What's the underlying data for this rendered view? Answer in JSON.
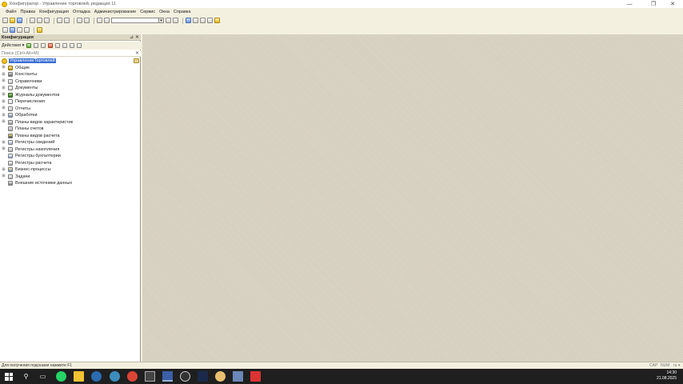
{
  "window": {
    "title": "Конфигуратор - Управление торговлей, редакция 11",
    "controls": {
      "minimize": "—",
      "maximize": "❐",
      "close": "✕"
    }
  },
  "menu": [
    "Файл",
    "Правка",
    "Конфигурация",
    "Отладка",
    "Администрирование",
    "Сервис",
    "Окна",
    "Справка"
  ],
  "panel": {
    "title": "Конфигурация",
    "pin": "⊿",
    "close": "✕",
    "actions_label": "Действия ▾",
    "search_placeholder": "Поиск (Ctrl+Alt+M)",
    "search_clear": "✕",
    "root_label": "УправлениеТорговлей",
    "items": [
      {
        "label": "Общие",
        "expander": "⊞",
        "icon": "common-icon"
      },
      {
        "label": "Константы",
        "expander": "⊞",
        "icon": "constants-icon"
      },
      {
        "label": "Справочники",
        "expander": "⊞",
        "icon": "catalogs-icon"
      },
      {
        "label": "Документы",
        "expander": "⊞",
        "icon": "documents-icon"
      },
      {
        "label": "Журналы документов",
        "expander": "⊞",
        "icon": "journals-icon"
      },
      {
        "label": "Перечисления",
        "expander": "⊞",
        "icon": "enumerations-icon"
      },
      {
        "label": "Отчеты",
        "expander": "⊞",
        "icon": "reports-icon"
      },
      {
        "label": "Обработки",
        "expander": "⊞",
        "icon": "data-processors-icon"
      },
      {
        "label": "Планы видов характеристик",
        "expander": "⊞",
        "icon": "chart-characteristics-icon"
      },
      {
        "label": "Планы счетов",
        "expander": "",
        "icon": "chart-accounts-icon"
      },
      {
        "label": "Планы видов расчета",
        "expander": "",
        "icon": "chart-calculation-icon"
      },
      {
        "label": "Регистры сведений",
        "expander": "⊞",
        "icon": "information-registers-icon"
      },
      {
        "label": "Регистры накопления",
        "expander": "⊞",
        "icon": "accumulation-registers-icon"
      },
      {
        "label": "Регистры бухгалтерии",
        "expander": "",
        "icon": "accounting-registers-icon"
      },
      {
        "label": "Регистры расчета",
        "expander": "",
        "icon": "calculation-registers-icon"
      },
      {
        "label": "Бизнес-процессы",
        "expander": "⊞",
        "icon": "business-processes-icon"
      },
      {
        "label": "Задачи",
        "expander": "⊞",
        "icon": "tasks-icon"
      },
      {
        "label": "Внешние источники данных",
        "expander": "",
        "icon": "external-sources-icon"
      }
    ]
  },
  "status": {
    "hint": "Для получения подсказки нажмите F1",
    "caps": "CAP",
    "num": "NUM",
    "lang": "ru ▾"
  },
  "taskbar": {
    "time": "14:30",
    "date": "21.08.2025"
  }
}
